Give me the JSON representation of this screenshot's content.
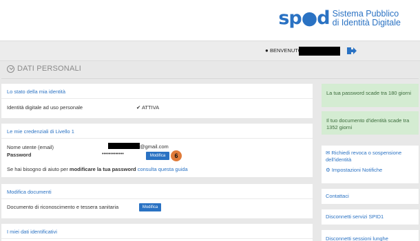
{
  "header": {
    "logo_mark": "sp●d",
    "logo_line1": "Sistema Pubblico",
    "logo_line2": "di Identità Digitale"
  },
  "userbar": {
    "welcome": "BENVENUTO"
  },
  "page": {
    "title": "DATI PERSONALI"
  },
  "identity": {
    "head": "Lo stato della mia identità",
    "label": "Identità digitale ad uso personale",
    "status": "✔ ATTIVA"
  },
  "credentials": {
    "head": "Le mie credenziali di Livello 1",
    "username_label": "Nome utente (email)",
    "username_suffix": "@gmail.com",
    "password_label": "Password",
    "password_value": "•••••••••••••",
    "edit_label": "Modifica",
    "badge": "6",
    "help_prefix": "Se hai bisogno di aiuto per ",
    "help_bold": "modificare la tua password",
    "help_link": "consulta questa guida"
  },
  "documents": {
    "head": "Modifica documenti",
    "label": "Documento di riconoscimento e tessera sanitaria",
    "edit_label": "Modifica"
  },
  "identifiers": {
    "head": "I miei dati identificativi"
  },
  "sidebar": {
    "password_notice": "La tua password scade tra 180 giorni",
    "document_notice": "Il tuo documento d'identità scade tra 1352 giorni",
    "revoke_link": "Richiedi revoca o sospensione dell'identità",
    "notifications_link": "Impostazioni Notifiche",
    "contacts_link": "Contattaci",
    "disconnect_services": "Disconnetti servizi SPID1",
    "disconnect_sessions": "Disconnetti sessioni lunghe"
  },
  "colors": {
    "accent": "#2a72c3",
    "notice_bg": "#d4ecd2",
    "badge": "#e07b39"
  }
}
